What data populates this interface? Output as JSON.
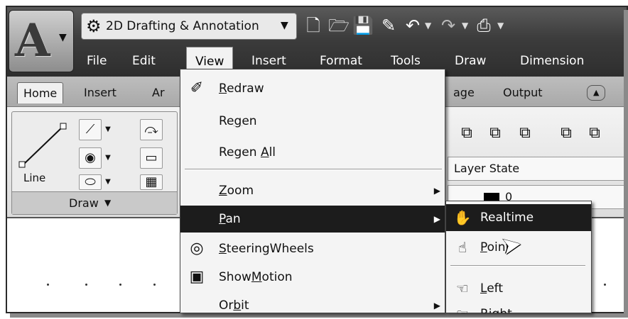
{
  "workspace": {
    "label": "2D Drafting & Annotation"
  },
  "menubar": {
    "items": [
      {
        "label": "File"
      },
      {
        "label": "Edit"
      },
      {
        "label": "View"
      },
      {
        "label": "Insert"
      },
      {
        "label": "Format"
      },
      {
        "label": "Tools"
      },
      {
        "label": "Draw"
      },
      {
        "label": "Dimension"
      }
    ]
  },
  "ribbon": {
    "tabs": [
      "Home",
      "Insert",
      "Ar",
      "age",
      "Output"
    ],
    "draw_panel": {
      "title": "Draw",
      "line_label": "Line"
    },
    "layer_state": "Layer State",
    "layer_current": "0"
  },
  "view_menu": {
    "redraw": {
      "pre": "",
      "mnemonic": "R",
      "post": "edraw"
    },
    "regen": {
      "pre": "Re",
      "mnemonic": "g",
      "post": "en"
    },
    "regen_all": {
      "pre": "Regen ",
      "mnemonic": "A",
      "post": "ll"
    },
    "zoom": {
      "pre": "",
      "mnemonic": "Z",
      "post": "oom"
    },
    "pan": {
      "pre": "",
      "mnemonic": "P",
      "post": "an"
    },
    "steering": {
      "pre": "",
      "mnemonic": "S",
      "post": "teeringWheels"
    },
    "showmotion": {
      "pre": "Show",
      "mnemonic": "M",
      "post": "otion"
    },
    "orbit": {
      "pre": "Or",
      "mnemonic": "b",
      "post": "it"
    }
  },
  "pan_submenu": {
    "realtime": "Realtime",
    "point": {
      "pre": "",
      "mnemonic": "P",
      "post": "oint"
    },
    "left": {
      "pre": "",
      "mnemonic": "L",
      "post": "eft"
    },
    "right": "Right"
  },
  "colors": {
    "menu_highlight": "#1c1c1c",
    "menu_bg": "#f4f4f4",
    "dark_bar": "#3c3c3c"
  }
}
